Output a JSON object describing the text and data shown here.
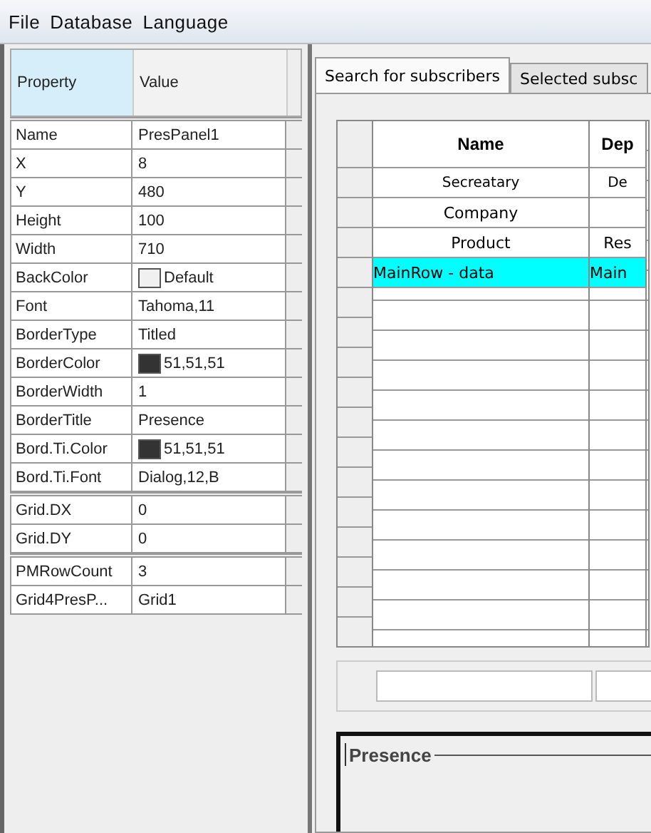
{
  "menu": [
    "File",
    "Database",
    "Language"
  ],
  "properties": {
    "columns": [
      {
        "label": "Property",
        "selected": true
      },
      {
        "label": "Value",
        "selected": false
      }
    ],
    "groups": [
      [
        {
          "name": "Name",
          "value": "PresPanel1"
        },
        {
          "name": "X",
          "value": "8"
        },
        {
          "name": "Y",
          "value": "480"
        },
        {
          "name": "Height",
          "value": "100"
        },
        {
          "name": "Width",
          "value": "710"
        },
        {
          "name": "BackColor",
          "value": "Default",
          "color": "#f0f0f0"
        },
        {
          "name": "Font",
          "value": "Tahoma,11"
        },
        {
          "name": "BorderType",
          "value": "Titled"
        },
        {
          "name": "BorderColor",
          "value": "51,51,51",
          "color": "#333333"
        },
        {
          "name": "BorderWidth",
          "value": "1"
        },
        {
          "name": "BorderTitle",
          "value": "Presence"
        },
        {
          "name": "Bord.Ti.Color",
          "value": "51,51,51",
          "color": "#333333"
        },
        {
          "name": "Bord.Ti.Font",
          "value": "Dialog,12,B"
        }
      ],
      [
        {
          "name": "Grid.DX",
          "value": "0"
        },
        {
          "name": "Grid.DY",
          "value": "0"
        }
      ],
      [
        {
          "name": "PMRowCount",
          "value": "3"
        },
        {
          "name": "Grid4PresP...",
          "value": "Grid1"
        }
      ]
    ]
  },
  "tabs": [
    {
      "label": "Search for subscribers",
      "selected": true
    },
    {
      "label": "Selected subsc",
      "selected": false
    }
  ],
  "table": {
    "columns": [
      "Name",
      "Dep"
    ],
    "rows": [
      {
        "kind": "small",
        "selected": false,
        "cells": [
          "Secreatary",
          "De"
        ]
      },
      {
        "kind": "caption",
        "selected": false,
        "cells": [
          "Company"
        ]
      },
      {
        "kind": "caption",
        "selected": false,
        "cells": [
          "Product",
          "Res"
        ]
      },
      {
        "kind": "data",
        "selected": true,
        "cells": [
          "MainRow - data",
          "Main"
        ]
      }
    ]
  },
  "panel": {
    "title": "Presence"
  }
}
